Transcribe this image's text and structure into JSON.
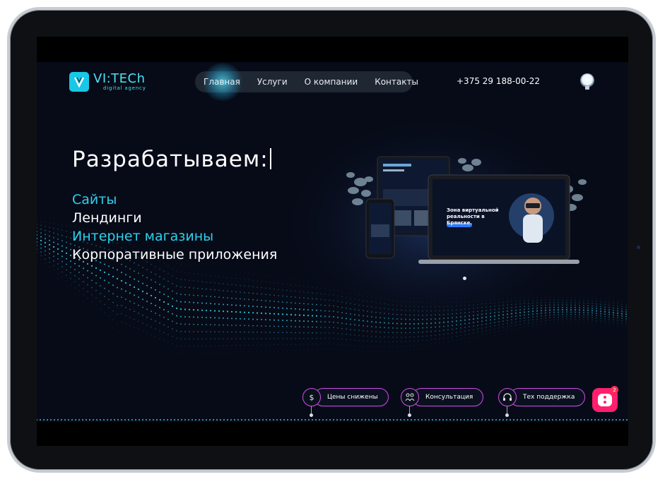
{
  "header": {
    "logo_name": "VI:TECh",
    "logo_tagline": "digital agency",
    "nav": [
      "Главная",
      "Услуги",
      "О компании",
      "Контакты"
    ],
    "phone": "+375 29 188-00-22"
  },
  "hero": {
    "title": "Разрабатываем:",
    "lines": [
      "Сайты",
      "Лендинги",
      "Интернет магазины",
      "Корпоративные приложения"
    ]
  },
  "mockup": {
    "headline": "Зона виртуальной реальности в Брянске."
  },
  "actions": [
    {
      "label": "Цены снижены",
      "icon": "dollar-icon"
    },
    {
      "label": "Консультация",
      "icon": "people-icon"
    },
    {
      "label": "Тех поддержка",
      "icon": "headset-icon"
    }
  ],
  "chat": {
    "badge": "2"
  },
  "colors": {
    "accent": "#2fd0ea",
    "pill_border": "#d44be8",
    "chat": "#ff1f6d"
  }
}
